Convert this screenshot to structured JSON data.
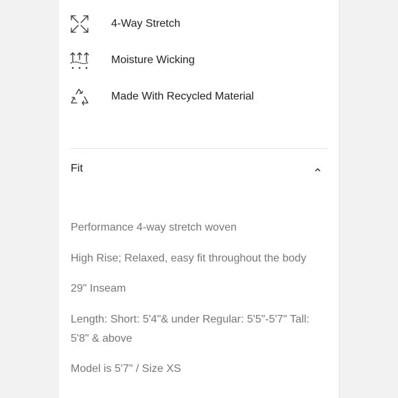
{
  "features": [
    {
      "icon": "arrows-expand-icon",
      "label": "4-Way Stretch"
    },
    {
      "icon": "moisture-wicking-icon",
      "label": "Moisture Wicking"
    },
    {
      "icon": "recycle-icon",
      "label": "Made With Recycled Material"
    }
  ],
  "accordion": {
    "title": "Fit",
    "state": "expanded",
    "chevron_icon": "chevron-up-icon"
  },
  "fit_details": [
    "Performance 4-way stretch woven",
    "High Rise; Relaxed, easy fit throughout the body",
    "29\" Inseam",
    "Length: Short: 5'4\"& under Regular: 5'5\"-5'7\" Tall: 5'8\" & above",
    "Model is 5'7\" / Size XS"
  ],
  "colors": {
    "background": "#f2f2f2",
    "panel": "#ffffff",
    "text_primary": "#222222",
    "text_secondary": "#777777",
    "divider": "#e6e6e6"
  }
}
